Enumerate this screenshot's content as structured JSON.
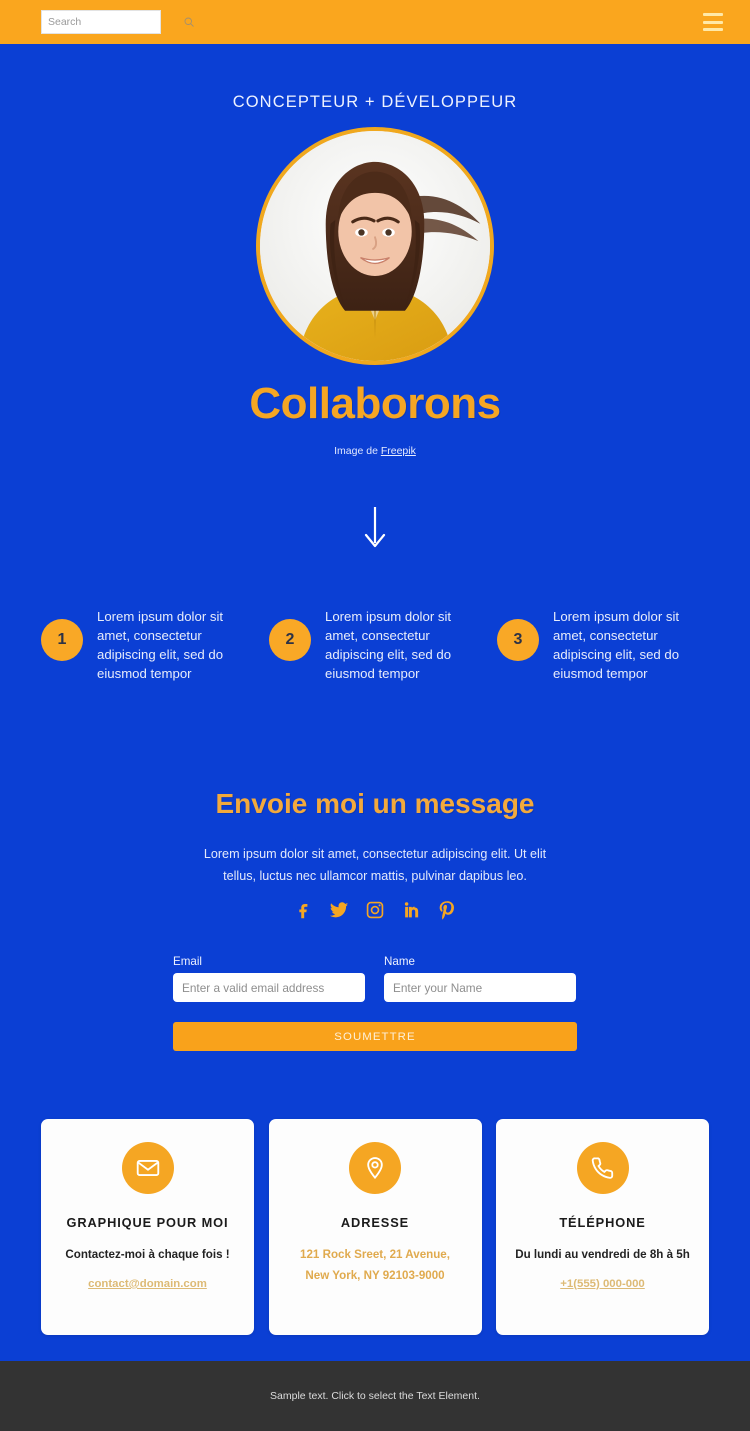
{
  "header": {
    "search_placeholder": "Search",
    "search_value": "",
    "search_icon": "search-icon",
    "menu_icon": "hamburger-menu-icon"
  },
  "hero": {
    "eyebrow": "CONCEPTEUR + DÉVELOPPEUR",
    "title": "Collaborons",
    "credit_prefix": "Image de ",
    "credit_link": "Freepik",
    "arrow_icon": "arrow-down-icon",
    "avatar_alt": "portrait-photo"
  },
  "steps": [
    {
      "number": "1",
      "text": "Lorem ipsum dolor sit amet, consectetur adipiscing elit, sed do eiusmod tempor"
    },
    {
      "number": "2",
      "text": "Lorem ipsum dolor sit amet, consectetur adipiscing elit, sed do eiusmod tempor"
    },
    {
      "number": "3",
      "text": "Lorem ipsum dolor sit amet, consectetur adipiscing elit, sed do eiusmod tempor"
    }
  ],
  "message": {
    "title": "Envoie moi un message",
    "subtitle": "Lorem ipsum dolor sit amet, consectetur adipiscing elit. Ut elit tellus, luctus nec ullamcor mattis, pulvinar dapibus leo.",
    "socials": [
      {
        "name": "facebook-icon"
      },
      {
        "name": "twitter-icon"
      },
      {
        "name": "instagram-icon"
      },
      {
        "name": "linkedin-icon"
      },
      {
        "name": "pinterest-icon"
      }
    ]
  },
  "form": {
    "email_label": "Email",
    "email_placeholder": "Enter a valid email address",
    "email_value": "",
    "name_label": "Name",
    "name_placeholder": "Enter your Name",
    "name_value": "",
    "submit_label": "SOUMETTRE"
  },
  "cards": [
    {
      "icon": "envelope-icon",
      "title": "GRAPHIQUE POUR MOI",
      "subtitle": "Contactez-moi à chaque fois !",
      "link": "contact@domain.com"
    },
    {
      "icon": "map-pin-icon",
      "title": "ADRESSE",
      "line1": "121 Rock Sreet, 21 Avenue,",
      "line2": "New York, NY 92103-9000"
    },
    {
      "icon": "phone-icon",
      "title": "TÉLÉPHONE",
      "subtitle": "Du lundi au vendredi de 8h à 5h",
      "link": "+1(555) 000-000"
    }
  ],
  "footer": {
    "text": "Sample text. Click to select the Text Element."
  },
  "colors": {
    "brand_blue": "#0b3fd4",
    "brand_orange": "#f5a623",
    "header_orange": "#faa61e",
    "footer_dark": "#333333"
  }
}
